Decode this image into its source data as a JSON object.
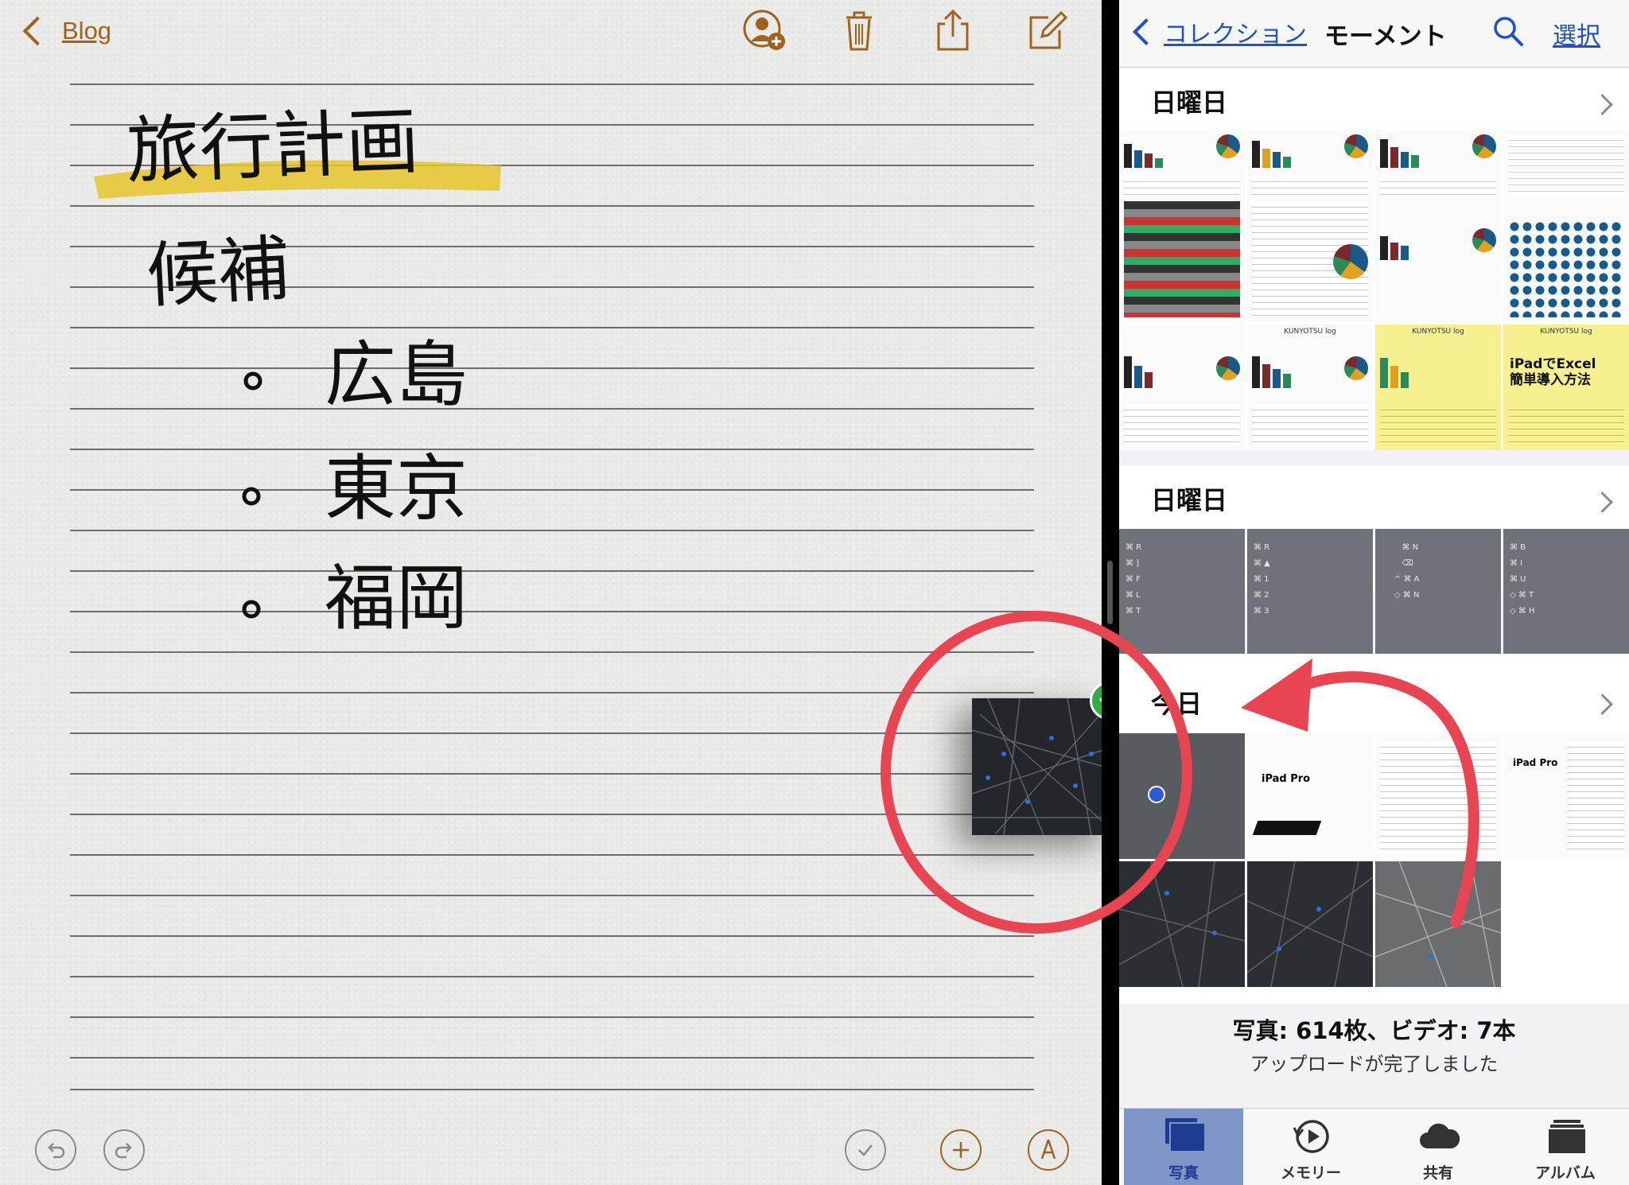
{
  "notes": {
    "back_label": "Blog",
    "toolbar": {
      "add_person_icon": "person-add-icon",
      "trash_icon": "trash-icon",
      "share_icon": "share-icon",
      "compose_icon": "compose-icon"
    },
    "handwriting": {
      "title": "旅行計画",
      "heading": "候補",
      "items": [
        "広島",
        "東京",
        "福岡"
      ]
    },
    "bottom_tools": [
      "undo-icon",
      "redo-icon",
      "checklist-icon",
      "add-icon",
      "markup-icon"
    ],
    "colors": {
      "accent": "#a0631b",
      "highlighter": "#e6c62a",
      "annotation": "#e94452",
      "drop_badge": "#2fb142"
    }
  },
  "photos": {
    "nav": {
      "back_label": "コレクション",
      "title": "モーメント",
      "select_label": "選択"
    },
    "sections": [
      {
        "title": "日曜日"
      },
      {
        "title": "日曜日"
      },
      {
        "title": "今日"
      }
    ],
    "thumb_captions": {
      "kunyotsu": "KUNYOTSU log",
      "ipad_excel": "iPadでExcel\n簡単導入方法",
      "ipad_pro": "iPad Pro"
    },
    "footer": {
      "count": "写真: 614枚、ビデオ: 7本",
      "status": "アップロードが完了しました"
    },
    "tabs": [
      {
        "label": "写真",
        "icon": "photos-icon",
        "active": true
      },
      {
        "label": "メモリー",
        "icon": "memories-icon",
        "active": false
      },
      {
        "label": "共有",
        "icon": "shared-cloud-icon",
        "active": false
      },
      {
        "label": "アルバム",
        "icon": "albums-icon",
        "active": false
      }
    ],
    "colors": {
      "link": "#1f4fd1",
      "active_tab": "#7f96c8"
    }
  }
}
